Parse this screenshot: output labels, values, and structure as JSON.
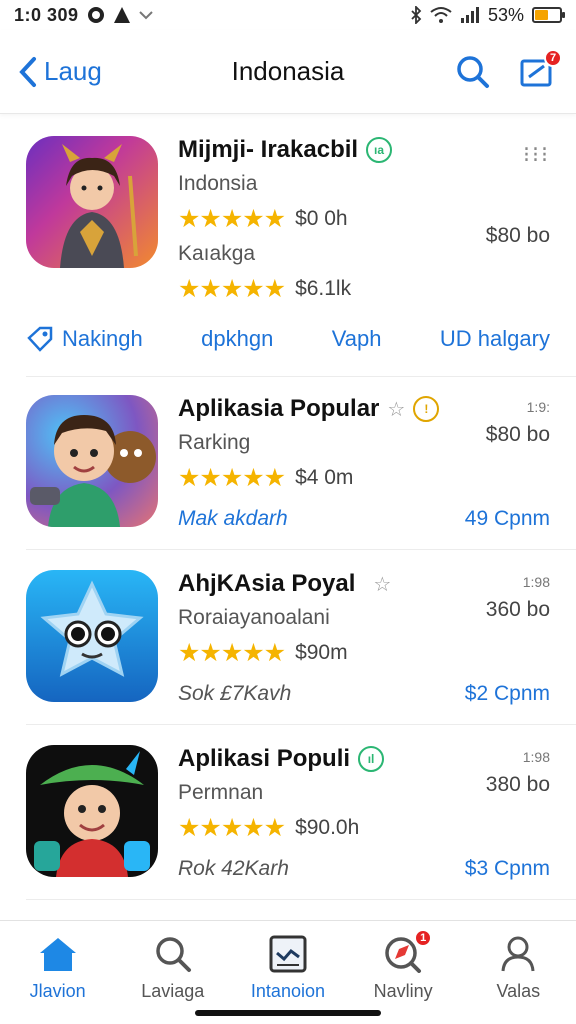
{
  "status": {
    "time": "1:0 309",
    "battery_pct": "53%",
    "battery_level": 0.53,
    "battery_color": "#f5a300"
  },
  "header": {
    "back_label": "Laug",
    "title": "Indonasia",
    "notif_badge": "7",
    "accent": "#1e73d8"
  },
  "cards": [
    {
      "name": "Mijmji- Irakacbil",
      "verify_glyph": "ıa",
      "subtitle": "Indonsia",
      "rating1": "$0 0h",
      "price1": "$80 bo",
      "sub2": "Kaıakga",
      "rating2": "$6.1lk",
      "stars": "★★★★★",
      "actions": [
        "Nakingh",
        "dpkhgn",
        "Vaph",
        "UD halgary"
      ]
    },
    {
      "name": "Aplikasia Popular",
      "verify_glyph": "!",
      "meta": "1:9:",
      "subtitle": "Rarking",
      "price": "$80 bo",
      "rating": "$4 0m",
      "stars": "★★★★★",
      "link_left": "Mak akdarh",
      "link_right": "49 Cpnm"
    },
    {
      "name": "AhjKAsia Poyal",
      "meta": "1:98",
      "subtitle": "Roraiayanoalani",
      "price": "360 bo",
      "rating": "$90m",
      "stars": "★★★★★",
      "link_left": "Sok £7Kavh",
      "link_right": "$2 Cpnm"
    },
    {
      "name": "Aplikasi Populi",
      "verify_glyph": "ıl",
      "meta": "1:98",
      "subtitle": "Permnan",
      "price": "380 bo",
      "rating": "$90.0h",
      "stars": "★★★★★",
      "link_left": "Rok 42Karh",
      "link_right": "$3 Cpnm"
    }
  ],
  "nav": [
    {
      "label": "Jlavion",
      "icon": "home-icon"
    },
    {
      "label": "Laviaga",
      "icon": "search-icon"
    },
    {
      "label": "Intanoion",
      "icon": "chart-icon"
    },
    {
      "label": "Navliny",
      "icon": "explore-icon",
      "badge": "1"
    },
    {
      "label": "Valas",
      "icon": "profile-icon"
    }
  ]
}
